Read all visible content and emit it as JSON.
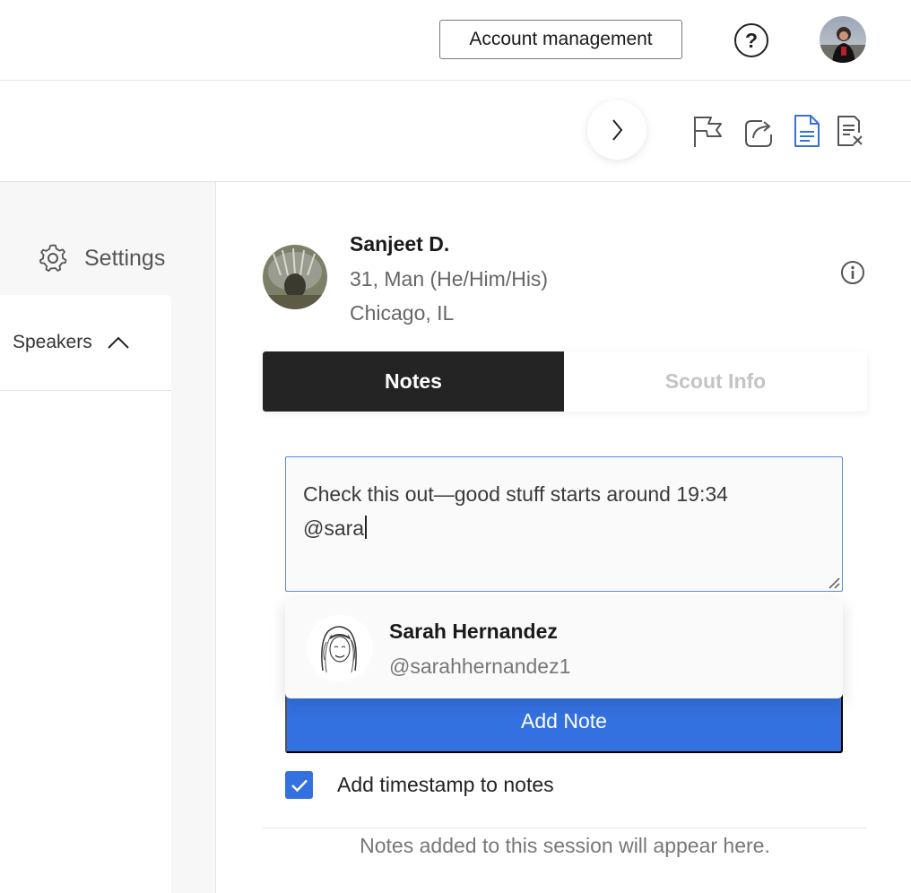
{
  "header": {
    "account_button": "Account management",
    "help_icon": "help-circle-icon",
    "user_avatar": "user-avatar"
  },
  "toolbar": {
    "chevron": "chevron-right-icon",
    "icons": [
      "flag-icon",
      "share-icon",
      "document-icon",
      "remove-document-icon"
    ],
    "active_color": "#3471e0"
  },
  "sidebar": {
    "settings_label": "Settings",
    "speakers_label": "Speakers"
  },
  "profile": {
    "name": "Sanjeet D.",
    "meta": "31, Man (He/Him/His)",
    "location": "Chicago, IL"
  },
  "tabs": [
    {
      "label": "Notes",
      "active": true
    },
    {
      "label": "Scout Info",
      "active": false
    }
  ],
  "note": {
    "line1": "Check this out—good stuff starts around 19:34",
    "line2": "@sara"
  },
  "mention": {
    "name": "Sarah Hernandez",
    "handle": "@sarahhernandez1"
  },
  "add_note_label": "Add Note",
  "timestamp_label": "Add timestamp to notes",
  "timestamp_checked": true,
  "empty_message": "Notes added to this session will appear here.",
  "colors": {
    "accent": "#3471e0",
    "tab_active_bg": "#242424"
  }
}
